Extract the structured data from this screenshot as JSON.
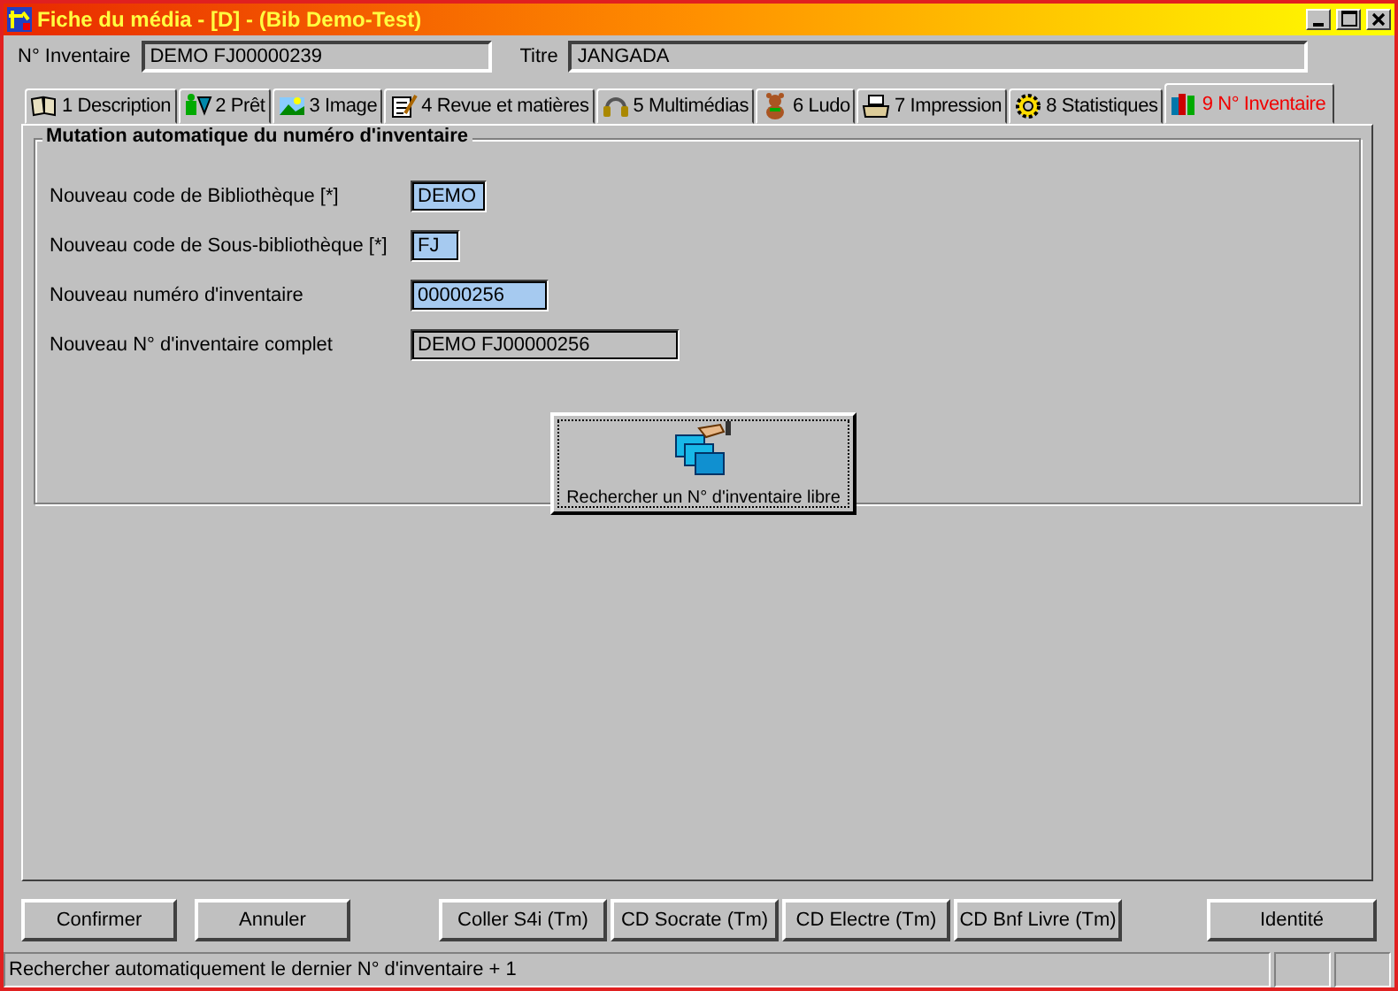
{
  "window": {
    "title": "Fiche du média - [D] - (Bib Demo-Test)"
  },
  "header": [
    {
      "label": "N° Inventaire",
      "value": "DEMO FJ00000239"
    },
    {
      "label": "Titre",
      "value": "JANGADA"
    }
  ],
  "tabs": [
    {
      "label": "1 Description",
      "selected": false
    },
    {
      "label": "2 Prêt",
      "selected": false
    },
    {
      "label": "3 Image",
      "selected": false
    },
    {
      "label": "4 Revue et matières",
      "selected": false
    },
    {
      "label": "5 Multimédias",
      "selected": false
    },
    {
      "label": "6 Ludo",
      "selected": false
    },
    {
      "label": "7 Impression",
      "selected": false
    },
    {
      "label": "8 Statistiques",
      "selected": false
    },
    {
      "label": "9 N° Inventaire",
      "selected": true
    }
  ],
  "group": {
    "title": "Mutation automatique du numéro d'inventaire",
    "fields": [
      {
        "label": "Nouveau code de Bibliothèque [*]",
        "value": "DEMO",
        "kind": "input"
      },
      {
        "label": "Nouveau code de Sous-bibliothèque [*]",
        "value": "FJ",
        "kind": "input"
      },
      {
        "label": "Nouveau numéro d'inventaire",
        "value": "00000256",
        "kind": "input"
      },
      {
        "label": "Nouveau N° d'inventaire complet",
        "value": "DEMO FJ00000256",
        "kind": "readonly"
      }
    ],
    "search_button": "Rechercher un N° d'inventaire libre"
  },
  "buttons": [
    "Confirmer",
    "Annuler",
    "Coller S4i (Tm)",
    "CD Socrate (Tm)",
    "CD Electre (Tm)",
    "CD Bnf Livre (Tm)",
    "Identité"
  ],
  "status_bar": {
    "text": "Rechercher automatiquement le dernier N° d'inventaire + 1"
  }
}
